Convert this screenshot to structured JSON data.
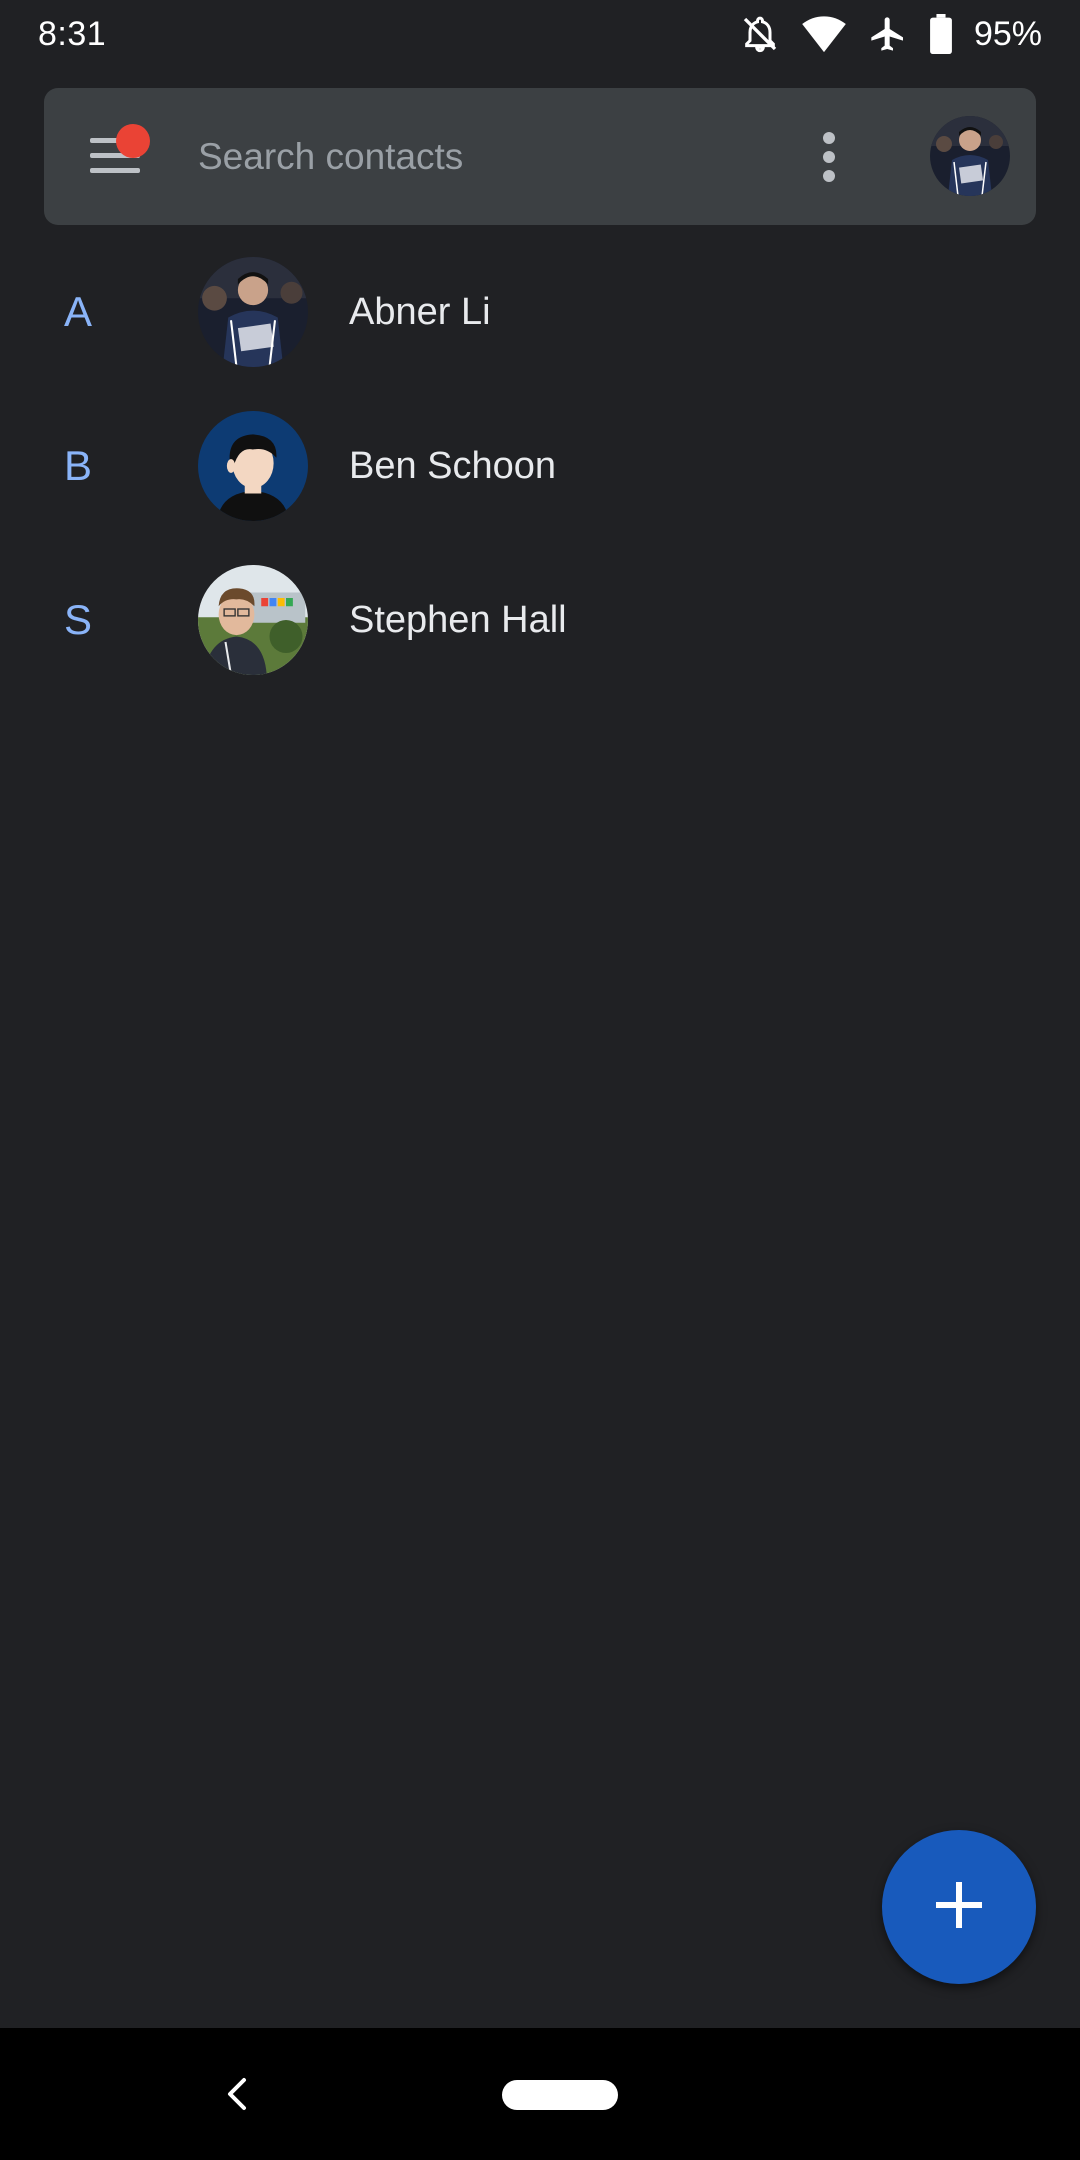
{
  "status_bar": {
    "time": "8:31",
    "icons": [
      "notifications-off-icon",
      "wifi-icon",
      "airplane-mode-icon",
      "battery-icon"
    ],
    "battery_percent": "95%"
  },
  "search": {
    "placeholder": "Search contacts",
    "menu_icon": "menu-icon",
    "notification_badge_color": "#ea4335",
    "more_icon": "more-vert-icon",
    "account_avatar": "account-avatar"
  },
  "contacts": [
    {
      "section": "A",
      "name": "Abner Li",
      "avatar": "photo"
    },
    {
      "section": "B",
      "name": "Ben Schoon",
      "avatar": "illustrated"
    },
    {
      "section": "S",
      "name": "Stephen Hall",
      "avatar": "photo"
    }
  ],
  "fab": {
    "icon": "add-icon",
    "color": "#185abc"
  },
  "nav_bar": {
    "back_icon": "back-icon",
    "home_icon": "home-pill"
  },
  "colors": {
    "background": "#202124",
    "search_bar": "#3c4043",
    "section_letter": "#8ab4f8",
    "text_primary": "#e8eaed",
    "text_secondary": "#9aa0a6"
  }
}
